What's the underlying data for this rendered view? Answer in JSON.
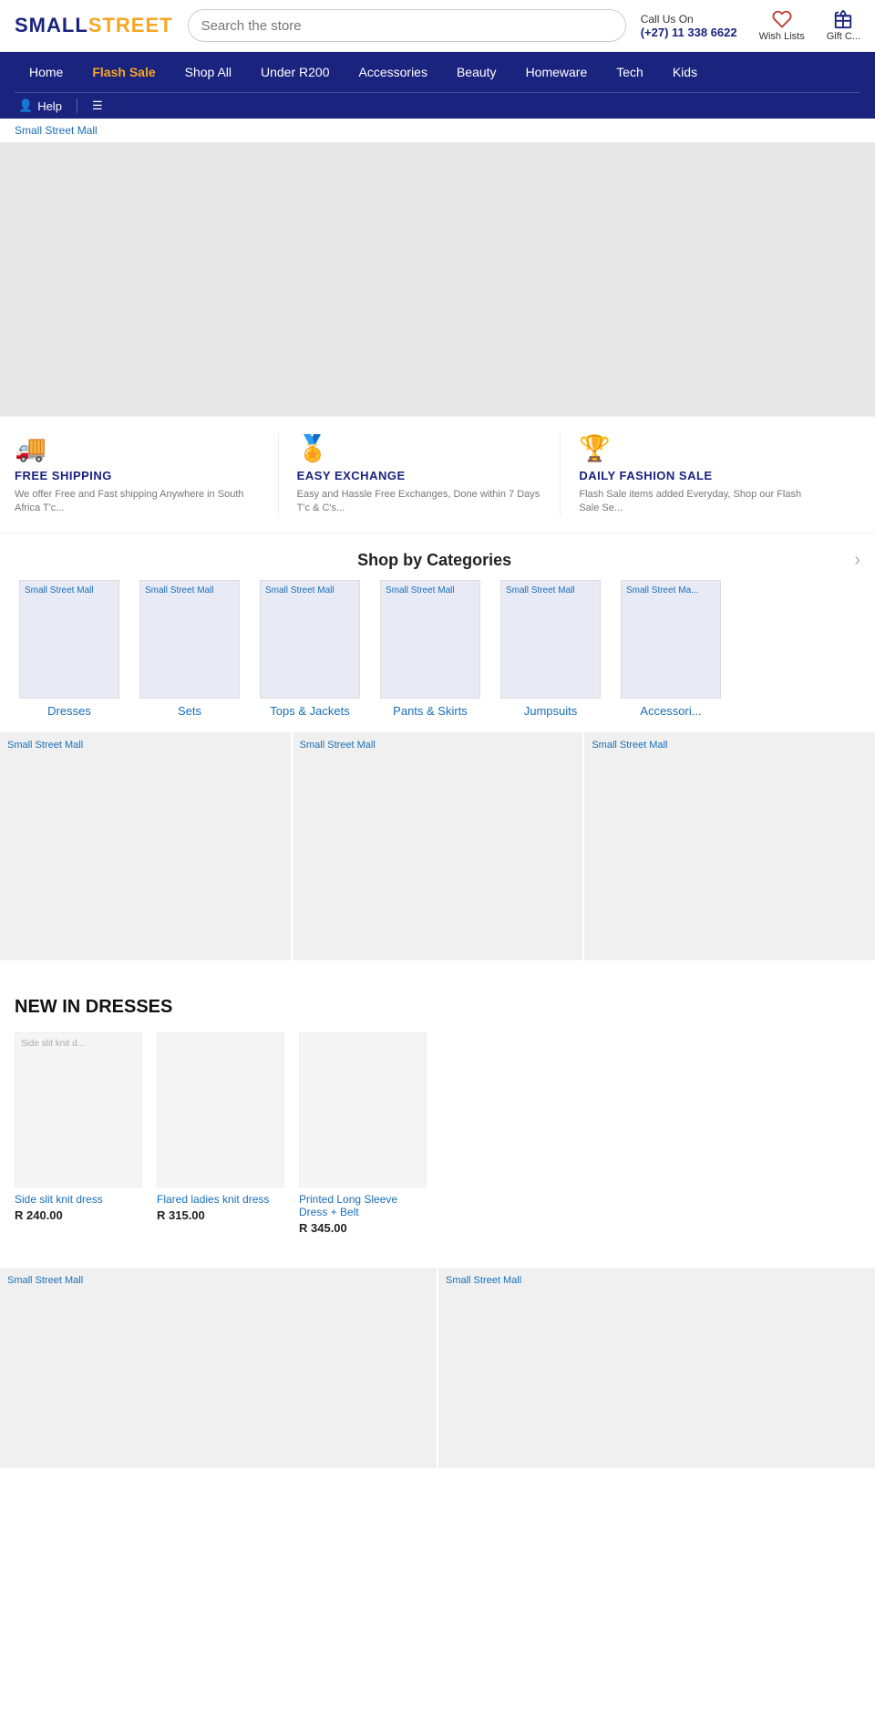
{
  "header": {
    "logo_small": "SMALL",
    "logo_street": "STREET",
    "search_placeholder": "Search the store",
    "call_label": "Call Us On",
    "phone": "(+27) 11 338 6622",
    "wish_lists_label": "Wish Lists",
    "gift_label": "Gift C..."
  },
  "nav": {
    "items": [
      {
        "label": "Home",
        "flash": false
      },
      {
        "label": "Flash Sale",
        "flash": true
      },
      {
        "label": "Shop All",
        "flash": false
      },
      {
        "label": "Under R200",
        "flash": false
      },
      {
        "label": "Accessories",
        "flash": false
      },
      {
        "label": "Beauty",
        "flash": false
      },
      {
        "label": "Homeware",
        "flash": false
      },
      {
        "label": "Tech",
        "flash": false
      },
      {
        "label": "Kids",
        "flash": false
      }
    ],
    "secondary": [
      {
        "label": "Help",
        "icon": "person"
      },
      {
        "label": "",
        "icon": "menu"
      }
    ]
  },
  "breadcrumb": "Small Street Mall",
  "features": [
    {
      "icon": "🚚",
      "title": "FREE SHIPPING",
      "desc": "We offer Free and Fast shipping Anywhere in South Africa T'c..."
    },
    {
      "icon": "🏅",
      "title": "EASY EXCHANGE",
      "desc": "Easy and Hassle Free Exchanges, Done within 7 Days T'c & C's..."
    },
    {
      "icon": "🏆",
      "title": "DAILY FASHION SALE",
      "desc": "Flash Sale items added Everyday, Shop our Flash Sale Se..."
    }
  ],
  "categories_section": {
    "title": "Shop by Categories",
    "items": [
      {
        "label": "Dresses",
        "img_text": "Small Street Mall"
      },
      {
        "label": "Sets",
        "img_text": "Small Street Mall"
      },
      {
        "label": "Tops & Jackets",
        "img_text": "Small Street Mall"
      },
      {
        "label": "Pants & Skirts",
        "img_text": "Small Street Mall"
      },
      {
        "label": "Jumpsuits",
        "img_text": "Small Street Mall"
      },
      {
        "label": "Accessori...",
        "img_text": "Small Street Ma..."
      }
    ]
  },
  "banner_cards": [
    {
      "img_text": "Small Street Mall"
    },
    {
      "img_text": "Small Street Mall"
    },
    {
      "img_text": "Small Street Mall"
    }
  ],
  "new_dresses": {
    "title": "NEW IN DRESSES",
    "products": [
      {
        "name": "Side slit knit dress",
        "price": "R 240.00",
        "img_text": "Side slit knit d..."
      },
      {
        "name": "Flared ladies knit dress",
        "price": "R 315.00",
        "img_text": ""
      },
      {
        "name": "Printed Long Sleeve Dress + Belt",
        "price": "R 345.00",
        "img_text": ""
      }
    ]
  },
  "bottom_banners": [
    {
      "img_text": "Small Street Mall"
    },
    {
      "img_text": "Small Street Mall"
    }
  ]
}
